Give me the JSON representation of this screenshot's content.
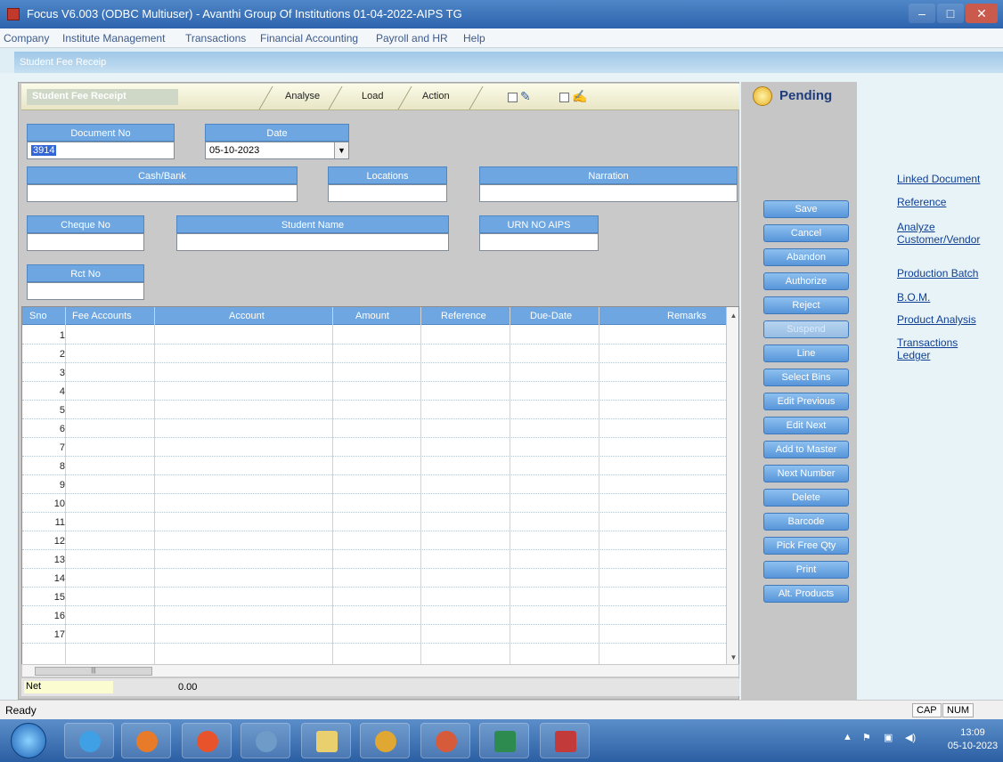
{
  "window": {
    "title": "Focus V6.003 (ODBC Multiuser) - Avanthi Group Of Institutions 01-04-2022-AIPS TG",
    "min_icon": "minimize-icon",
    "max_icon": "maximize-icon",
    "close_icon": "close-icon"
  },
  "menu": [
    "Company",
    "Institute Management",
    "Transactions",
    "Financial Accounting",
    "Payroll and HR",
    "Help"
  ],
  "document_tab": "Student Fee Receip",
  "toolbar": {
    "title": "Student Fee Receipt",
    "analyse": "Analyse",
    "load": "Load",
    "action": "Action"
  },
  "fields": {
    "document_no": {
      "label": "Document No",
      "value": "3914"
    },
    "date": {
      "label": "Date",
      "value": "05-10-2023"
    },
    "cash_bank": {
      "label": "Cash/Bank",
      "value": ""
    },
    "locations": {
      "label": "Locations",
      "value": ""
    },
    "narration": {
      "label": "Narration",
      "value": ""
    },
    "cheque_no": {
      "label": "Cheque No",
      "value": ""
    },
    "student_name": {
      "label": "Student Name",
      "value": ""
    },
    "urn_no": {
      "label": "URN NO AIPS",
      "value": ""
    },
    "rct_no": {
      "label": "Rct No",
      "value": ""
    }
  },
  "grid": {
    "columns": [
      "Sno",
      "Fee Accounts",
      "Account",
      "Amount",
      "Reference",
      "Due-Date",
      "Remarks"
    ],
    "rows": [
      "1",
      "2",
      "3",
      "4",
      "5",
      "6",
      "7",
      "8",
      "9",
      "10",
      "11",
      "12",
      "13",
      "14",
      "15",
      "16",
      "17"
    ]
  },
  "net": {
    "label": "Net",
    "value": "0.00"
  },
  "status": {
    "label": "Pending"
  },
  "actions": [
    {
      "label": "Save",
      "enabled": true
    },
    {
      "label": "Cancel",
      "enabled": true
    },
    {
      "label": "Abandon",
      "enabled": true
    },
    {
      "label": "Authorize",
      "enabled": true
    },
    {
      "label": "Reject",
      "enabled": true
    },
    {
      "label": "Suspend",
      "enabled": false
    },
    {
      "label": "Line",
      "enabled": true
    },
    {
      "label": "Select Bins",
      "enabled": true
    },
    {
      "label": "Edit Previous",
      "enabled": true
    },
    {
      "label": "Edit Next",
      "enabled": true
    },
    {
      "label": "Add to Master",
      "enabled": true
    },
    {
      "label": "Next Number",
      "enabled": true
    },
    {
      "label": "Delete",
      "enabled": true
    },
    {
      "label": "Barcode",
      "enabled": true
    },
    {
      "label": "Pick Free Qty",
      "enabled": true
    },
    {
      "label": "Print",
      "enabled": true
    },
    {
      "label": "Alt. Products",
      "enabled": true
    }
  ],
  "links": [
    "Linked Document",
    "Reference",
    "Analyze Customer/Vendor",
    "Production Batch",
    "B.O.M.",
    "Product Analysis",
    "Transactions Ledger"
  ],
  "statusbar": {
    "ready": "Ready",
    "cap": "CAP",
    "num": "NUM"
  },
  "taskbar": {
    "time": "13:09",
    "date": "05-10-2023",
    "icons": [
      "windows-start-icon",
      "ie-icon",
      "media-player-icon",
      "firefox-icon",
      "network-icon",
      "file-explorer-icon",
      "chrome-icon",
      "chrome-alt-icon",
      "excel-icon",
      "focus-app-icon"
    ]
  },
  "colors": {
    "label_blue": "#6da6e0",
    "title_blue": "#2d63ad",
    "link_blue": "#0f3f93"
  }
}
